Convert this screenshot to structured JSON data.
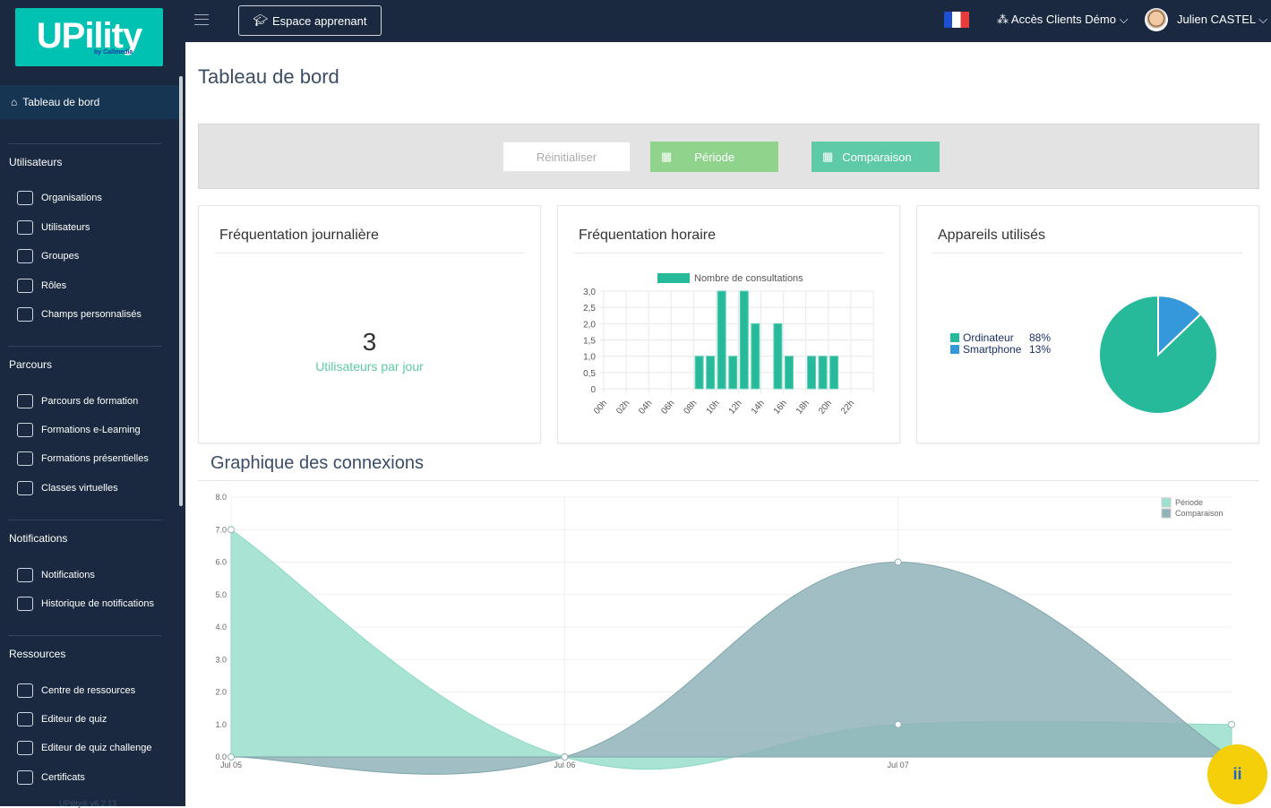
{
  "brand": {
    "logo_text": "UPility",
    "logo_sub": "by Callmedia",
    "version": "UPility® v6.2.13"
  },
  "topbar": {
    "learner_space": "Espace apprenant",
    "client_access": "Accès Clients Démo",
    "user_name": "Julien CASTEL",
    "language": "fr"
  },
  "sidebar": {
    "active": "Tableau de bord",
    "sections": [
      {
        "title": "Utilisateurs",
        "items": [
          "Organisations",
          "Utilisateurs",
          "Groupes",
          "Rôles",
          "Champs personnalisés"
        ]
      },
      {
        "title": "Parcours",
        "items": [
          "Parcours de formation",
          "Formations e-Learning",
          "Formations présentielles",
          "Classes virtuelles"
        ]
      },
      {
        "title": "Notifications",
        "items": [
          "Notifications",
          "Historique de notifications"
        ]
      },
      {
        "title": "Ressources",
        "items": [
          "Centre de ressources",
          "Editeur de quiz",
          "Editeur de quiz challenge",
          "Certificats"
        ]
      }
    ]
  },
  "page": {
    "title": "Tableau de bord"
  },
  "filters": {
    "reset": "Réinitialiser",
    "period": "Période",
    "comparison": "Comparaison"
  },
  "cards": {
    "daily": {
      "title": "Fréquentation journalière",
      "value": "3",
      "label": "Utilisateurs par jour"
    },
    "hourly": {
      "title": "Fréquentation horaire"
    },
    "devices": {
      "title": "Appareils utilisés"
    }
  },
  "connections": {
    "title": "Graphique des connexions"
  },
  "chat_icon": "chat-icon",
  "colors": {
    "accent": "#26b99a",
    "period_btn": "#8fd38c",
    "comparison_btn": "#5ecaa7",
    "smartphone": "#3498db",
    "comparison_area": "#8fb3b8"
  },
  "chart_data": [
    {
      "type": "bar",
      "legend": "Nombre de consultations",
      "categories": [
        "00h",
        "01h",
        "02h",
        "03h",
        "04h",
        "05h",
        "06h",
        "07h",
        "08h",
        "09h",
        "10h",
        "11h",
        "12h",
        "13h",
        "14h",
        "15h",
        "16h",
        "17h",
        "18h",
        "19h",
        "20h",
        "21h",
        "22h",
        "23h"
      ],
      "tick_labels": [
        "00h",
        "02h",
        "04h",
        "06h",
        "08h",
        "10h",
        "12h",
        "14h",
        "16h",
        "18h",
        "20h",
        "22h"
      ],
      "values": [
        0,
        0,
        0,
        0,
        0,
        0,
        0,
        0,
        1,
        1,
        3,
        1,
        3,
        2,
        0,
        2,
        1,
        0,
        1,
        1,
        1,
        0,
        0,
        0
      ],
      "yticks": [
        "0",
        "0,5",
        "1,0",
        "1,5",
        "2,0",
        "2,5",
        "3,0"
      ],
      "ylim": [
        0,
        3
      ],
      "grid": true,
      "legend_position": "top"
    },
    {
      "type": "pie",
      "labels": [
        "Ordinateur",
        "Smartphone"
      ],
      "values": [
        88,
        13
      ],
      "value_labels": [
        "88%",
        "13%"
      ],
      "colors": [
        "#26b99a",
        "#3498db"
      ],
      "legend_position": "left"
    },
    {
      "type": "area",
      "x": [
        "Jul 05",
        "Jul 06",
        "Jul 07",
        "Jul 08"
      ],
      "x_labels": [
        "Jul 05",
        "Jul 06",
        "Jul 07"
      ],
      "series": [
        {
          "name": "Période",
          "values": [
            7,
            0,
            1,
            1
          ],
          "color": "#9ee0cf"
        },
        {
          "name": "Comparaison",
          "values": [
            0,
            0,
            6,
            0
          ],
          "color": "#8fb3b8"
        }
      ],
      "yticks": [
        "0.0",
        "1.0",
        "2.0",
        "3.0",
        "4.0",
        "5.0",
        "6.0",
        "7.0",
        "8.0"
      ],
      "ylim": [
        0,
        8
      ],
      "grid": true,
      "legend_position": "top-right"
    }
  ]
}
